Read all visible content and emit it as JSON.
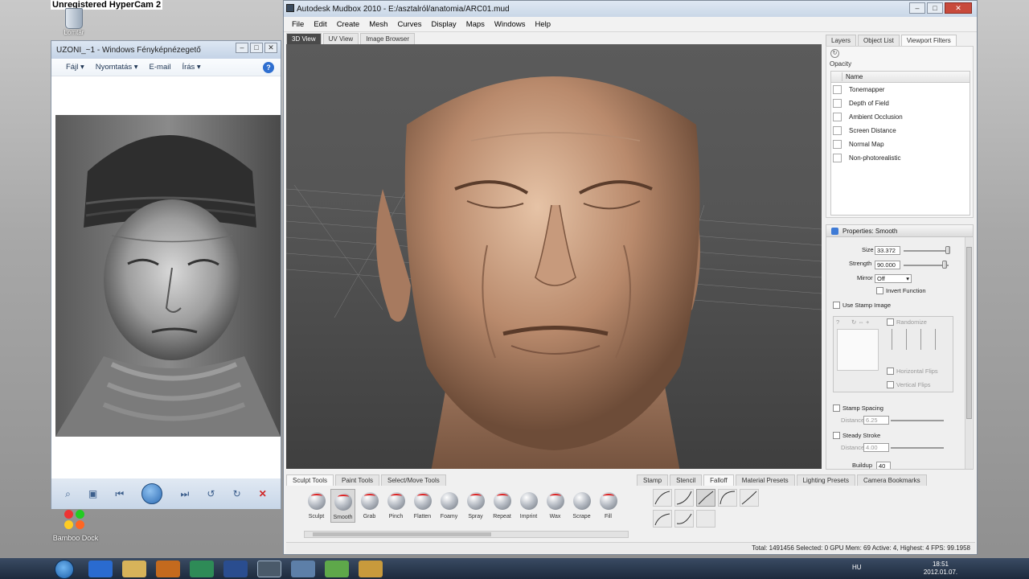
{
  "desktop": {
    "hypercam_label": "Unregistered HyperCam 2",
    "recycle_label": "Lomtár",
    "bamboo_label": "Bamboo Dock"
  },
  "viewer": {
    "title": "UZONI_~1 - Windows Fényképnézegető",
    "menu": [
      "Fájl ▾",
      "Nyomtatás ▾",
      "E-mail",
      "Írás ▾"
    ],
    "controls": [
      "magnifier-icon",
      "fit-icon",
      "previous-icon",
      "slideshow-icon",
      "next-icon",
      "rotate-left-icon",
      "rotate-right-icon",
      "delete-icon"
    ]
  },
  "mudbox": {
    "title": "Autodesk Mudbox 2010 - E:/asztalról/anatomia/ARC01.mud",
    "menu": [
      "File",
      "Edit",
      "Create",
      "Mesh",
      "Curves",
      "Display",
      "Maps",
      "Windows",
      "Help"
    ],
    "view_tabs": [
      "3D View",
      "UV View",
      "Image Browser"
    ],
    "right_tabs": [
      "Layers",
      "Object List",
      "Viewport Filters"
    ],
    "filters": {
      "opacity_label": "Opacity",
      "header": "Name",
      "items": [
        "Tonemapper",
        "Depth of Field",
        "Ambient Occlusion",
        "Screen Distance",
        "Normal Map",
        "Non-photorealistic"
      ]
    },
    "properties": {
      "title": "Properties: Smooth",
      "size_label": "Size",
      "size_value": "33.372",
      "strength_label": "Strength",
      "strength_value": "90.000",
      "mirror_label": "Mirror",
      "mirror_value": "Off",
      "invert_label": "Invert Function",
      "use_stamp_label": "Use Stamp Image",
      "randomize_label": "Randomize",
      "hflip_label": "Horizontal Flips",
      "vflip_label": "Vertical Flips",
      "stamp_spacing_label": "Stamp Spacing",
      "distance_label": "Distance",
      "distance1_value": "6.25",
      "steady_label": "Steady Stroke",
      "distance2_value": "4.00",
      "buildup_label": "Buildup",
      "buildup_value": "40"
    },
    "tool_tabs": [
      "Sculpt Tools",
      "Paint Tools",
      "Select/Move Tools"
    ],
    "tools": [
      "Sculpt",
      "Smooth",
      "Grab",
      "Pinch",
      "Flatten",
      "Foamy",
      "Spray",
      "Repeat",
      "Imprint",
      "Wax",
      "Scrape",
      "Fill"
    ],
    "stamp_tabs": [
      "Stamp",
      "Stencil",
      "Falloff",
      "Material Presets",
      "Lighting Presets",
      "Camera Bookmarks"
    ],
    "status": "Total: 1491456  Selected: 0 GPU Mem: 69  Active: 4, Highest: 4  FPS: 99.1958"
  },
  "taskbar": {
    "language": "HU",
    "time": "18:51",
    "date": "2012.01.07."
  }
}
